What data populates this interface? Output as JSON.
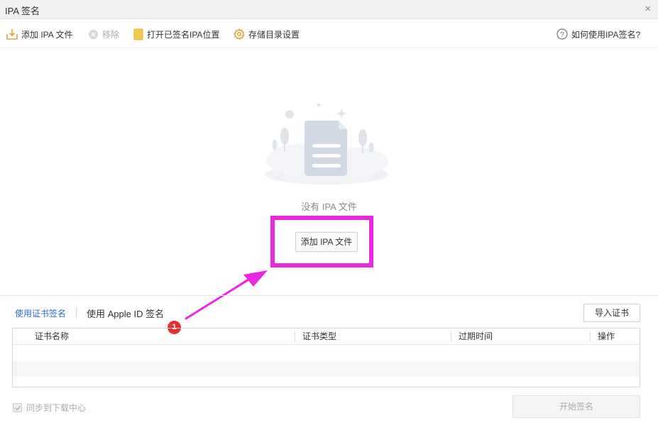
{
  "window": {
    "title": "IPA 签名",
    "close_symbol": "×"
  },
  "toolbar": {
    "add_ipa": "添加 IPA 文件",
    "remove": "移除",
    "open_signed_location": "打开已签名IPA位置",
    "storage_settings": "存储目录设置",
    "help": "如何使用IPA签名?"
  },
  "empty_state": {
    "message": "没有 IPA 文件",
    "add_button": "添加 IPA 文件"
  },
  "annotation": {
    "badge_number": "1",
    "highlight_color": "#ea28e0",
    "arrow_color": "#ea28e0"
  },
  "sign_tabs": {
    "cert_sign": "使用证书签名",
    "apple_id_sign": "使用 Apple ID 签名"
  },
  "import_cert_button": "导入证书",
  "cert_table": {
    "columns": [
      "证书名称",
      "证书类型",
      "过期时间",
      "操作"
    ],
    "rows": []
  },
  "sync_option": {
    "label": "同步到下载中心",
    "checked": true,
    "disabled": true
  },
  "start_sign_button": "开始签名",
  "colors": {
    "accent_blue": "#2f6bd8",
    "icon_orange": "#e6a23c",
    "folder_yellow": "#f5c94c"
  }
}
